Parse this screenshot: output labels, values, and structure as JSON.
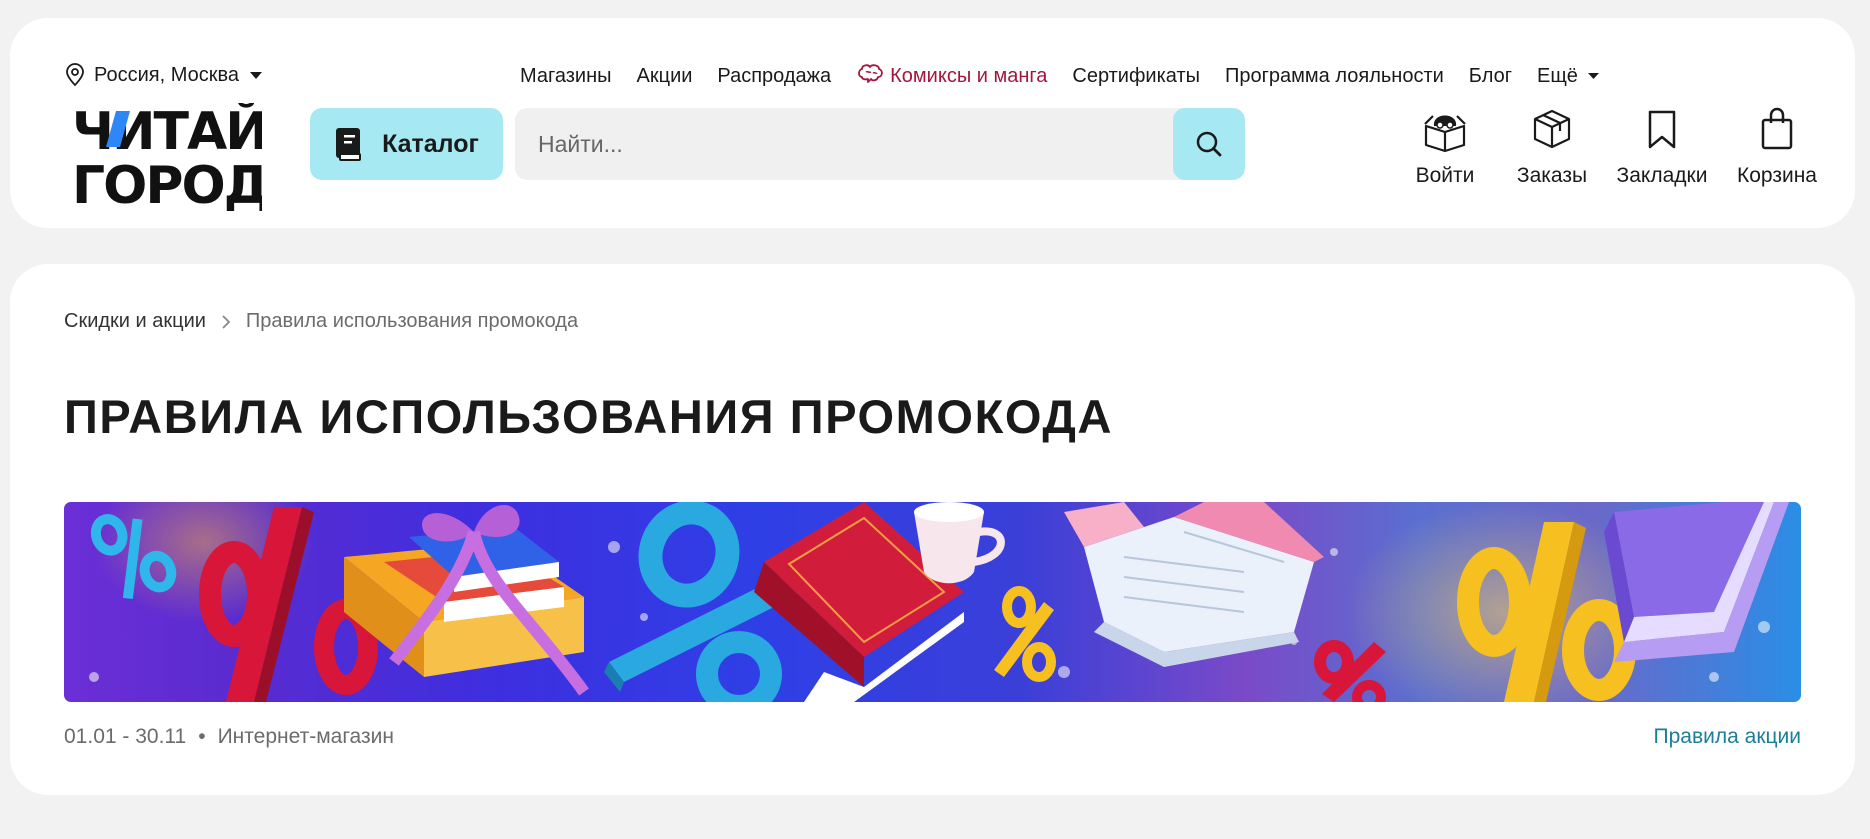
{
  "header": {
    "location": {
      "label": "Россия, Москва",
      "icon": "map-pin-icon"
    },
    "topnav": {
      "stores": "Магазины",
      "promos": "Акции",
      "sale": "Распродажа",
      "comics": "Комиксы и манга",
      "certificates": "Сертификаты",
      "loyalty": "Программа лояльности",
      "blog": "Блог",
      "more": "Ещё"
    },
    "logo": {
      "line1_part1": "ЧИ",
      "line1_part2": "ТАЙ",
      "line2": "ГОРОД"
    },
    "catalog_button": "Каталог",
    "search": {
      "placeholder": "Найти..."
    },
    "actions": {
      "login": "Войти",
      "orders": "Заказы",
      "bookmarks": "Закладки",
      "cart": "Корзина"
    }
  },
  "main": {
    "breadcrumb": {
      "parent": "Скидки и акции",
      "current": "Правила использования промокода"
    },
    "title": "ПРАВИЛА ИСПОЛЬЗОВАНИЯ ПРОМОКОДА",
    "meta": {
      "dates": "01.01 - 30.11",
      "separator": "•",
      "channel": "Интернет-магазин"
    },
    "rules_link": "Правила акции"
  },
  "colors": {
    "accent_cyan": "#a6e9f2",
    "comics_red": "#a4163d",
    "link_teal": "#1b7e9a",
    "logo_blue": "#2f86f5"
  }
}
